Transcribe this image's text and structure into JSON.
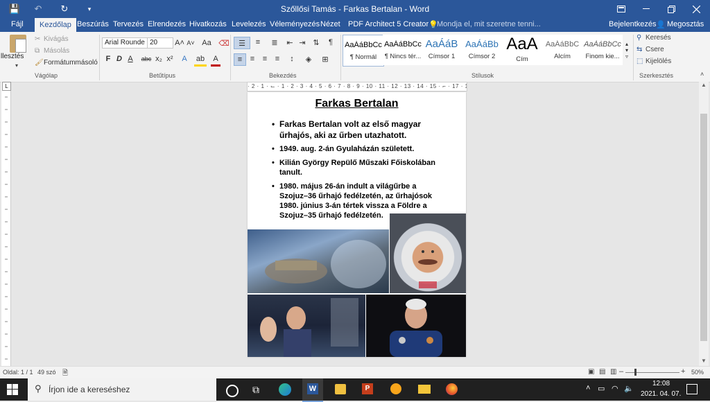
{
  "titlebar": {
    "title": "Szőllősi Tamás - Farkas Bertalan - Word",
    "qa_save": "💾",
    "qa_undo": "↶",
    "qa_redo": "↻",
    "qa_more": "▾"
  },
  "tabs": [
    "Fájl",
    "Kezdőlap",
    "Beszúrás",
    "Tervezés",
    "Elrendezés",
    "Hivatkozás",
    "Levelezés",
    "Véleményezés",
    "Nézet",
    "PDF Architect 5 Creator"
  ],
  "tell_me": "Mondja el, mit szeretne tenni...",
  "signin": "Bejelentkezés",
  "share": "Megosztás",
  "ribbon": {
    "clipboard": {
      "paste": "llesztés",
      "cut": "Kivágás",
      "copy": "Másolás",
      "format_painter": "Formátummásoló",
      "label": "Vágólap"
    },
    "font": {
      "name": "Arial Rounde",
      "size": "20",
      "label": "Betűtípus",
      "bold": "F",
      "italic": "D",
      "underline": "A",
      "strike": "abc",
      "sub": "x₂",
      "sup": "x²",
      "grow": "A˄",
      "shrink": "A˅",
      "case": "Aa"
    },
    "paragraph": {
      "label": "Bekezdés",
      "pilcrow": "¶"
    },
    "styles": {
      "label": "Stílusok",
      "tiles": [
        {
          "sample": "AaÁáBbCc",
          "name": "¶ Normál"
        },
        {
          "sample": "AaÁáBbCc",
          "name": "¶ Nincs tér..."
        },
        {
          "sample": "AaÁáB",
          "name": "Címsor 1"
        },
        {
          "sample": "AaÁáBb",
          "name": "Címsor 2"
        },
        {
          "sample": "AaA",
          "name": "Cím"
        },
        {
          "sample": "AaÁáBbC",
          "name": "Alcím"
        },
        {
          "sample": "AaÁáBbCc",
          "name": "Finom kie..."
        }
      ]
    },
    "editing": {
      "find": "Keresés",
      "replace": "Csere",
      "select": "Kijelölés",
      "label": "Szerkesztés"
    }
  },
  "ruler": "· 2 · 1 · ⌙ · 1 · 2 · 3 · 4 · 5 · 6 · 7 · 8 · 9 · 10 · 11 · 12 · 13 · 14 · 15 · ⌐ · 17 · 18",
  "document": {
    "heading": "Farkas Bertalan",
    "bullets": [
      "Farkas Bertalan volt az első magyar űrhajós, aki az űrben utazhatott.",
      "1949. aug. 2-án Gyulaházán született.",
      "Kilián György Repülő Műszaki Főiskolában tanult.",
      "1980. május 26-án indult a világűrbe a Szojuz–36 űrhajó fedélzetén, az űrhajósok 1980. június 3-án tértek vissza a Földre a Szojuz–35 űrhajó fedélzetén."
    ]
  },
  "status": {
    "page": "Oldal: 1 / 1",
    "words": "49 szó",
    "zoom": "50%"
  },
  "taskbar": {
    "search": "Írjon ide a kereséshez",
    "time": "12:08",
    "date": "2021. 04. 07."
  },
  "colors": {
    "word_blue": "#2b579a",
    "ribbon_bg": "#f3f3f3",
    "taskbar": "#202020"
  }
}
